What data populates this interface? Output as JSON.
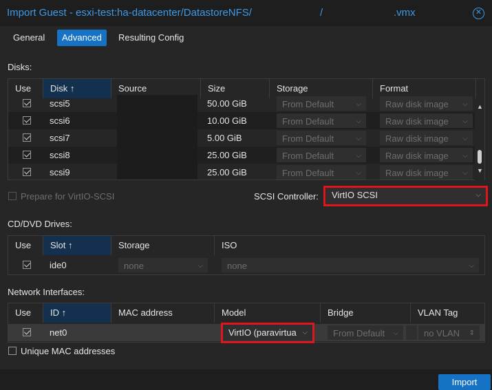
{
  "window": {
    "title_prefix": "Import Guest - esxi-test:ha-datacenter/DatastoreNFS/",
    "title_sep": "/",
    "title_suffix": ".vmx",
    "close_icon": "close-circle-icon"
  },
  "tabs": [
    {
      "label": "General",
      "active": false
    },
    {
      "label": "Advanced",
      "active": true
    },
    {
      "label": "Resulting Config",
      "active": false
    }
  ],
  "disks": {
    "section_label": "Disks:",
    "columns": {
      "use": "Use",
      "disk": "Disk",
      "sort_icon": "↑",
      "source": "Source",
      "size": "Size",
      "storage": "Storage",
      "format": "Format"
    },
    "rows": [
      {
        "use": true,
        "disk": "scsi5",
        "size": "50.00 GiB",
        "storage": "From Default",
        "format": "Raw disk image"
      },
      {
        "use": true,
        "disk": "scsi6",
        "size": "10.00 GiB",
        "storage": "From Default",
        "format": "Raw disk image"
      },
      {
        "use": true,
        "disk": "scsi7",
        "size": "5.00 GiB",
        "storage": "From Default",
        "format": "Raw disk image"
      },
      {
        "use": true,
        "disk": "scsi8",
        "size": "25.00 GiB",
        "storage": "From Default",
        "format": "Raw disk image"
      },
      {
        "use": true,
        "disk": "scsi9",
        "size": "25.00 GiB",
        "storage": "From Default",
        "format": "Raw disk image"
      }
    ],
    "prepare_virtio_label": "Prepare for VirtIO-SCSI",
    "scsi_controller_label": "SCSI Controller:",
    "scsi_controller_value": "VirtIO SCSI"
  },
  "cdrom": {
    "section_label": "CD/DVD Drives:",
    "columns": {
      "use": "Use",
      "slot": "Slot",
      "sort_icon": "↑",
      "storage": "Storage",
      "iso": "ISO"
    },
    "rows": [
      {
        "use": true,
        "slot": "ide0",
        "storage": "none",
        "iso": "none"
      }
    ]
  },
  "network": {
    "section_label": "Network Interfaces:",
    "columns": {
      "use": "Use",
      "id": "ID",
      "sort_icon": "↑",
      "mac": "MAC address",
      "model": "Model",
      "bridge": "Bridge",
      "vlan": "VLAN Tag"
    },
    "rows": [
      {
        "use": true,
        "id": "net0",
        "mac": "",
        "model": "VirtIO (paravirtua",
        "bridge": "From Default",
        "vlan": "no VLAN"
      }
    ],
    "unique_mac_label": "Unique MAC addresses"
  },
  "footer": {
    "import_label": "Import"
  },
  "colors": {
    "accent": "#1572c4",
    "title": "#3d9ae8",
    "highlight": "#e0161e",
    "background": "#262626"
  }
}
